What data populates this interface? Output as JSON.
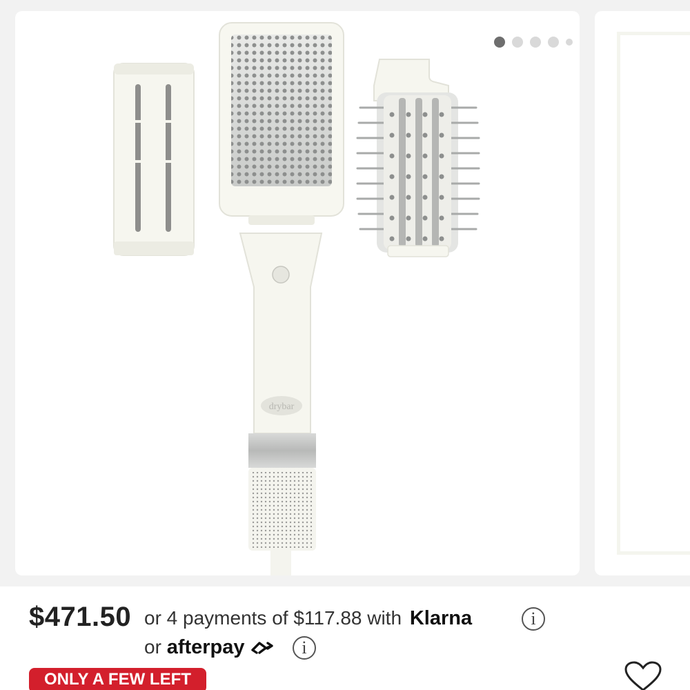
{
  "carousel": {
    "dots": 5,
    "active_index": 0
  },
  "pricing": {
    "price": "$471.50",
    "installment_text": "or 4 payments of $117.88 with",
    "klarna_label": "Klarna",
    "afterpay_prefix": "or",
    "afterpay_label": "afterpay",
    "info_glyph": "i"
  },
  "badge": {
    "label": "ONLY A FEW LEFT",
    "color": "#d31f2c"
  },
  "product_image": {
    "brand_mark": "drybar"
  },
  "icons": {
    "favorite": "heart-icon",
    "info": "info-icon"
  }
}
